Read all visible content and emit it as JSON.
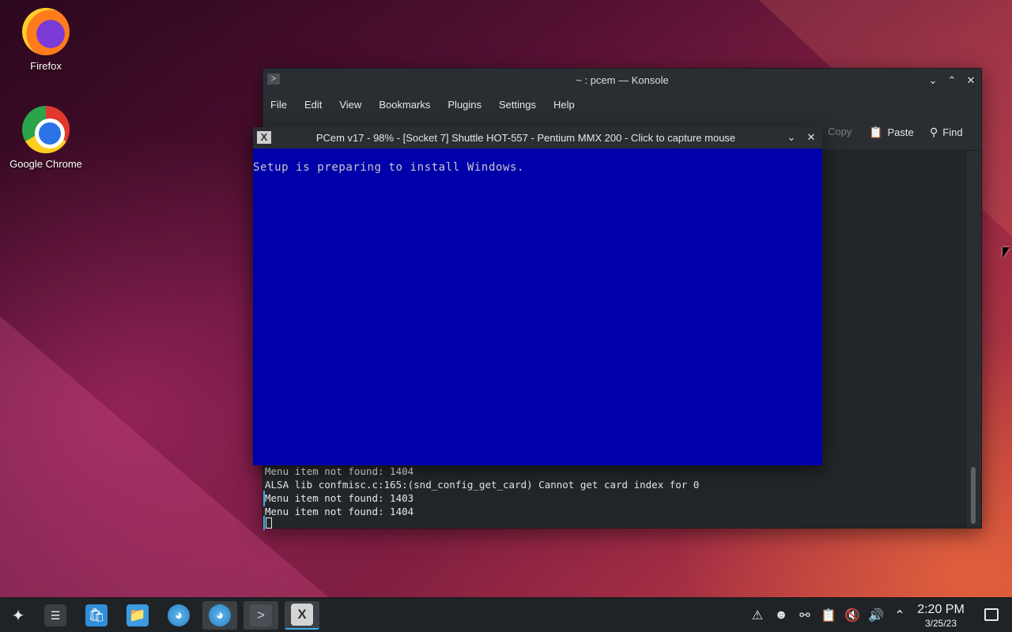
{
  "desktop": {
    "icons": [
      {
        "label": "Firefox",
        "icon": "firefox-icon"
      },
      {
        "label": "Google Chrome",
        "icon": "chrome-icon"
      }
    ]
  },
  "konsole": {
    "title": "~ : pcem — Konsole",
    "menu": [
      "File",
      "Edit",
      "View",
      "Bookmarks",
      "Plugins",
      "Settings",
      "Help"
    ],
    "toolbar": {
      "copy": "Copy",
      "paste": "Paste",
      "find": "Find"
    },
    "lines": [
      "Menu item not found: 1404",
      "ALSA lib confmisc.c:165:(snd_config_get_card) Cannot get card index for 0",
      "Menu item not found: 1403",
      "Menu item not found: 1404"
    ]
  },
  "pcem": {
    "title": "PCem v17 - 98% - [Socket 7] Shuttle HOT-557 - Pentium MMX 200 - Click to capture mouse",
    "screen_text": "Setup is preparing to install Windows.",
    "screen_color": "#0000aa"
  },
  "taskbar": {
    "items": [
      "app-launcher-icon",
      "system-settings-icon",
      "discover-store-icon",
      "dolphin-files-icon",
      "browser-globe-icon",
      "browser-globe-icon",
      "konsole-icon",
      "pcem-x-icon"
    ],
    "clock": {
      "time": "2:20 PM",
      "date": "3/25/23"
    },
    "accent": "#3daee9"
  }
}
